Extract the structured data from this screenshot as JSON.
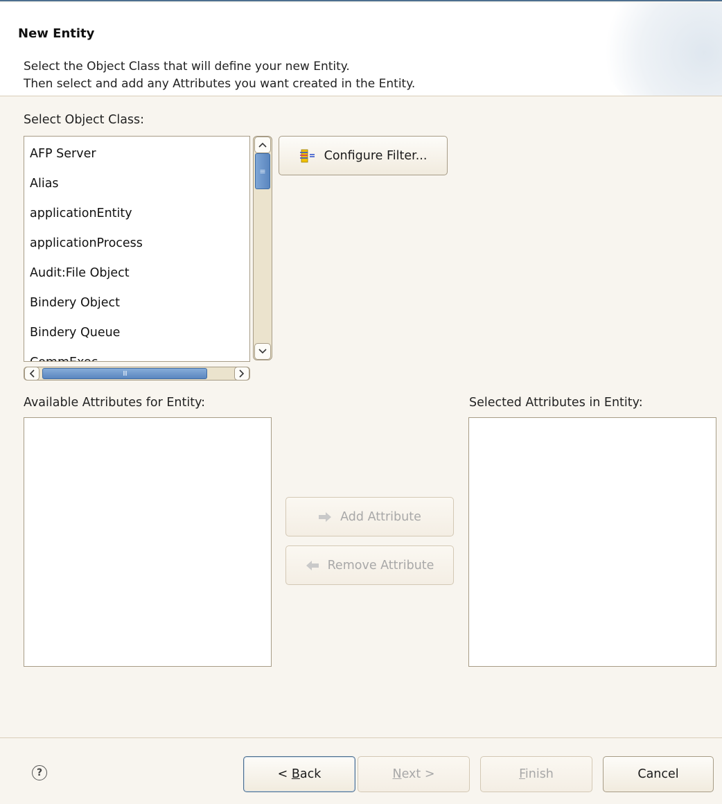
{
  "header": {
    "title": "New Entity",
    "description_line1": "Select the Object Class that will define your new Entity.",
    "description_line2": "Then select and add any Attributes you want created in the Entity."
  },
  "object_class": {
    "label": "Select Object Class:",
    "items": [
      "AFP Server",
      "Alias",
      "applicationEntity",
      "applicationProcess",
      "Audit:File Object",
      "Bindery Object",
      "Bindery Queue",
      "CommExec"
    ],
    "configure_filter_label": "Configure Filter..."
  },
  "attributes": {
    "available_label": "Available Attributes for Entity:",
    "selected_label": "Selected Attributes in Entity:",
    "add_label": "Add Attribute",
    "remove_label": "Remove Attribute"
  },
  "footer": {
    "back_prefix": "< ",
    "back_mnemonic": "B",
    "back_rest": "ack",
    "next_mnemonic": "N",
    "next_rest": "ext >",
    "finish_mnemonic": "F",
    "finish_rest": "inish",
    "cancel_label": "Cancel"
  },
  "colors": {
    "background": "#f8f5ef",
    "accent": "#4d6f8f",
    "scroll_thumb": "#5a86bf"
  },
  "icons": {
    "filter": "filter-icon",
    "add": "arrow-right-icon",
    "remove": "arrow-left-icon",
    "help": "help-icon"
  }
}
